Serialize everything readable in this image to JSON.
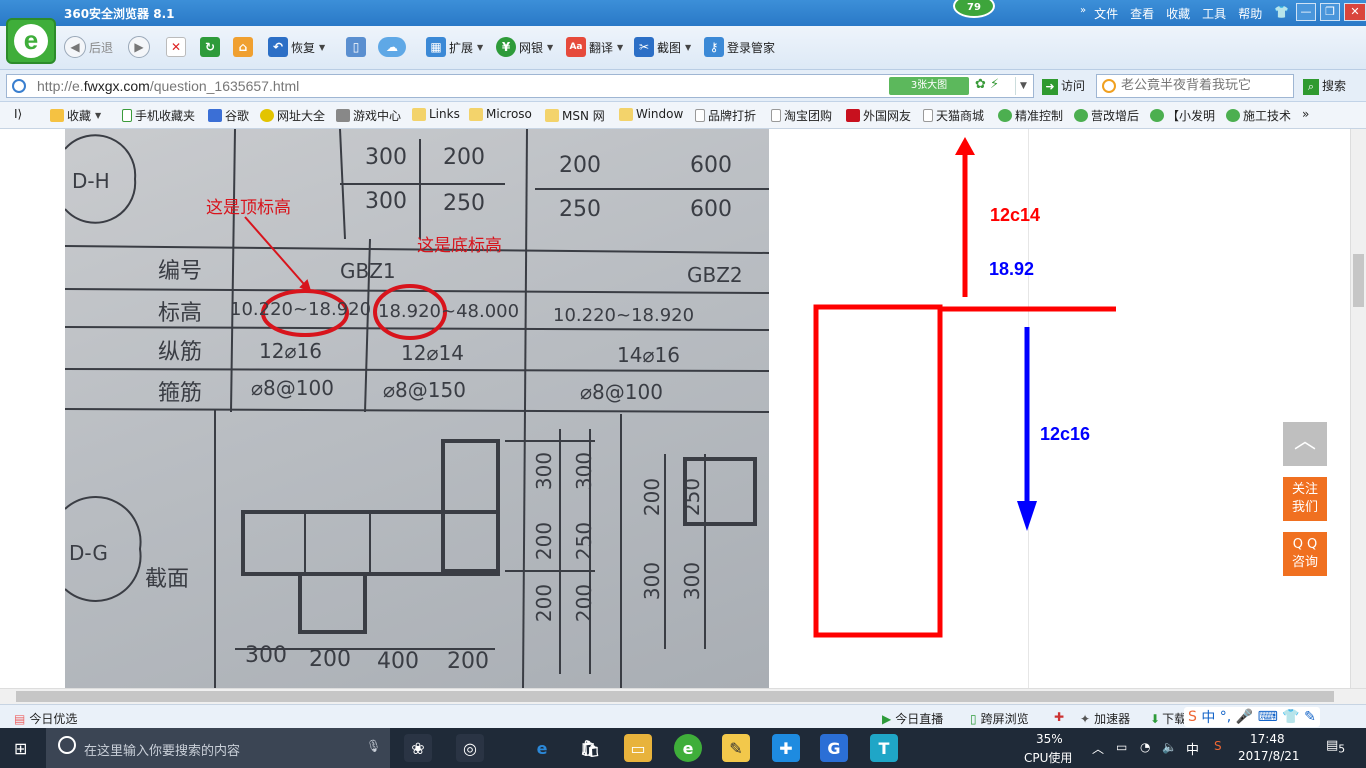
{
  "window": {
    "title": "360安全浏览器 8.1",
    "badge": "79",
    "menus": [
      "文件",
      "查看",
      "收藏",
      "工具",
      "帮助"
    ],
    "controls": {
      "minimize": "—",
      "maximize": "❐",
      "close": "✕"
    }
  },
  "toolbar": {
    "back": "后退",
    "restore": "恢复",
    "extend": "扩展",
    "bank": "网银",
    "translate": "翻译",
    "screenshot": "截图",
    "login_manager": "登录管家"
  },
  "address": {
    "url_prefix": "http://e.",
    "url_domain": "fwxgx.com",
    "url_path": "/question_1635657.html",
    "big_pic": "3张大图",
    "visit": "访问",
    "search_placeholder": "老公竟半夜背着我玩它",
    "search_button": "搜索"
  },
  "bookmarks": [
    "收藏",
    "手机收藏夹",
    "谷歌",
    "网址大全",
    "游戏中心",
    "Links",
    "Microso",
    "MSN 网",
    "Window",
    "品牌打折",
    "淘宝团购",
    "外国网友",
    "天猫商城",
    "精准控制",
    "营改增后",
    "【小发明",
    "施工技术"
  ],
  "photo": {
    "note_top": "这是顶标高",
    "note_bottom": "这是底标高",
    "row_number": "编号",
    "row_elevation": "标高",
    "row_long_bar": "纵筋",
    "row_stirrup": "箍筋",
    "section": "截面",
    "gbz1": "GBZ1",
    "gbz2": "GBZ2",
    "elev_1a": "10.220~18.920",
    "elev_1b": "18.920~48.000",
    "elev_2": "10.220~18.920",
    "bar_1a": "12⌀16",
    "bar_1b": "12⌀14",
    "bar_2": "14⌀16",
    "stir_1a": "⌀8@100",
    "stir_1b": "⌀8@150",
    "stir_2": "⌀8@100",
    "grid_dh": "D-H",
    "grid_dg": "D-G",
    "dims_top": [
      "300",
      "200",
      "300",
      "250",
      "200",
      "600",
      "250",
      "600"
    ],
    "dims_bottom": [
      "300",
      "200",
      "400",
      "200"
    ],
    "dims_vertical": [
      "300",
      "300",
      "200",
      "250",
      "200",
      "200",
      "200",
      "250",
      "300",
      "300"
    ]
  },
  "drawing": {
    "label_up": "12c14",
    "label_value": "18.92",
    "label_down": "12c16",
    "colors": {
      "red": "#ff0000",
      "blue": "#0000ff"
    }
  },
  "side": {
    "top_icon": "top-icon",
    "follow": [
      "关注",
      "我们"
    ],
    "qq": [
      "Q Q",
      "咨询"
    ]
  },
  "status": {
    "today_pick": "今日优选",
    "live": "今日直播",
    "cross_screen": "跨屏浏览",
    "accelerator": "加速器",
    "download": "下载"
  },
  "taskbar": {
    "search_placeholder": "在这里输入你要搜索的内容",
    "cpu_percent": "35%",
    "cpu_label": "CPU使用",
    "ime": "中",
    "time": "17:48",
    "date": "2017/8/21",
    "notifications": "5"
  }
}
